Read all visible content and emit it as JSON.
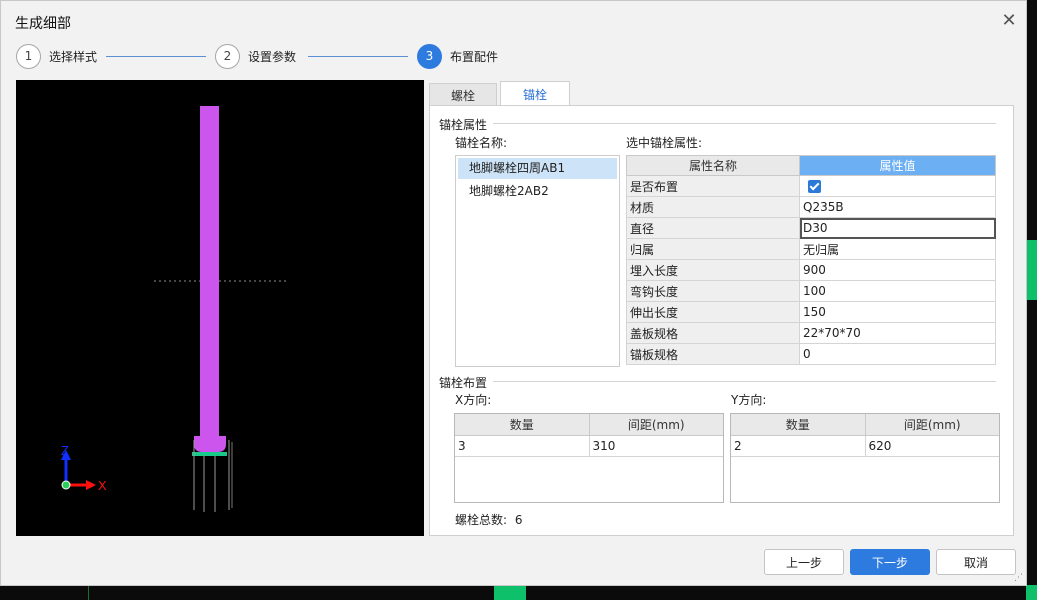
{
  "dialog": {
    "title": "生成细部",
    "close_glyph": "✕"
  },
  "steps": [
    {
      "num": "1",
      "label": "选择样式",
      "active": false
    },
    {
      "num": "2",
      "label": "设置参数",
      "active": false
    },
    {
      "num": "3",
      "label": "布置配件",
      "active": true
    }
  ],
  "viewport": {
    "axis_z": "Z",
    "axis_x": "X",
    "colors": {
      "column": "#cc55ee",
      "base_plate": "#19c98a",
      "axis_z": "#1030ff",
      "axis_x": "#ff1010"
    }
  },
  "tabs": [
    {
      "label": "螺栓",
      "active": false
    },
    {
      "label": "锚栓",
      "active": true
    }
  ],
  "anchor_props": {
    "group_title": "锚栓属性",
    "name_label": "锚栓名称:",
    "selected_props_label": "选中锚栓属性:",
    "names": [
      {
        "label": "地脚螺栓四周AB1",
        "selected": true
      },
      {
        "label": "地脚螺栓2AB2",
        "selected": false
      }
    ],
    "table_headers": {
      "name": "属性名称",
      "value": "属性值"
    },
    "rows": [
      {
        "name": "是否布置",
        "value": "",
        "checkbox": true
      },
      {
        "name": "材质",
        "value": "Q235B"
      },
      {
        "name": "直径",
        "value": "D30",
        "focused": true
      },
      {
        "name": "归属",
        "value": "无归属"
      },
      {
        "name": "埋入长度",
        "value": "900"
      },
      {
        "name": "弯钩长度",
        "value": "100"
      },
      {
        "name": "伸出长度",
        "value": "150"
      },
      {
        "name": "盖板规格",
        "value": "22*70*70"
      },
      {
        "name": "锚板规格",
        "value": "0"
      }
    ]
  },
  "layout_section": {
    "group_title": "锚栓布置",
    "x_label": "X方向:",
    "y_label": "Y方向:",
    "x_table": {
      "headers": [
        "数量",
        "间距(mm)"
      ],
      "rows": [
        [
          "3",
          "310"
        ]
      ]
    },
    "y_table": {
      "headers": [
        "数量",
        "间距(mm)"
      ],
      "rows": [
        [
          "2",
          "620"
        ]
      ]
    },
    "total_label": "螺栓总数:",
    "total_value": "6"
  },
  "buttons": {
    "prev": "上一步",
    "next": "下一步",
    "cancel": "取消"
  },
  "colors": {
    "accent": "#2e7be0",
    "header_selected": "#6cb0f3",
    "list_selected": "#cde3f7"
  }
}
